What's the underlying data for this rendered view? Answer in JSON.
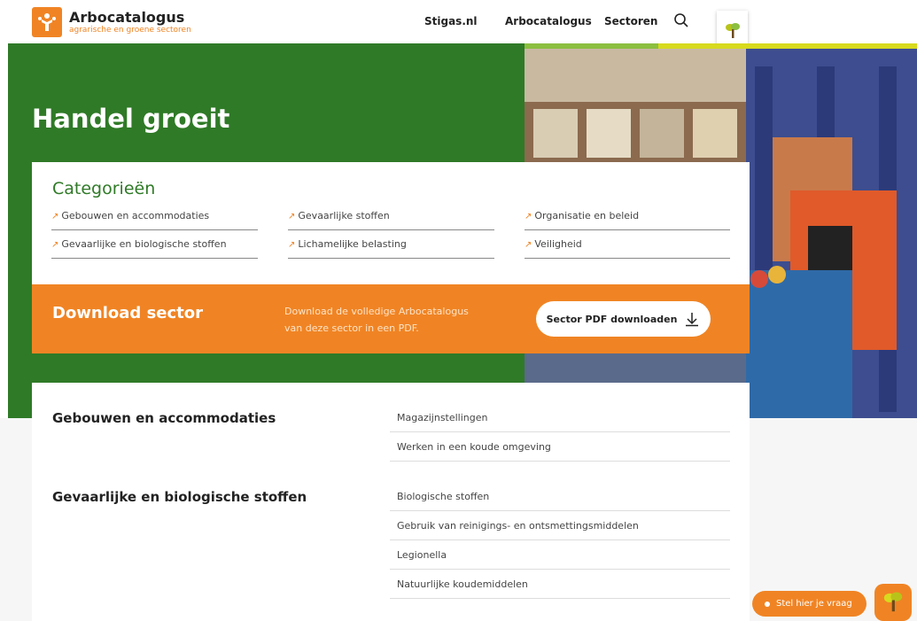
{
  "header": {
    "logo_name": "Arbocatalogus",
    "logo_tag": "agrarische en groene sectoren",
    "nav": [
      "Stigas.nl",
      "Arbocatalogus",
      "Sectoren"
    ]
  },
  "hero": {
    "title": "Handel groeit"
  },
  "categories": {
    "title": "Categorieën",
    "items": [
      "Gebouwen en accommodaties",
      "Gevaarlijke stoffen",
      "Organisatie en beleid",
      "Gevaarlijke en biologische stoffen",
      "Lichamelijke belasting",
      "Veiligheid"
    ]
  },
  "download": {
    "title": "Download sector",
    "description": "Download de volledige Arbocatalogus van deze sector in een PDF.",
    "button": "Sector PDF downloaden"
  },
  "sections": [
    {
      "heading": "Gebouwen en accommodaties",
      "items": [
        "Magazijnstellingen",
        "Werken in een koude omgeving"
      ]
    },
    {
      "heading": "Gevaarlijke en biologische stoffen",
      "items": [
        "Biologische stoffen",
        "Gebruik van reinigings- en ontsmettingsmiddelen",
        "Legionella",
        "Natuurlijke koudemiddelen"
      ]
    }
  ],
  "chat": {
    "label": "Stel hier je vraag"
  },
  "colors": {
    "green": "#2f7a27",
    "orange": "#f08424",
    "lime": "#8cbf3f",
    "yellow": "#d7da1e"
  }
}
